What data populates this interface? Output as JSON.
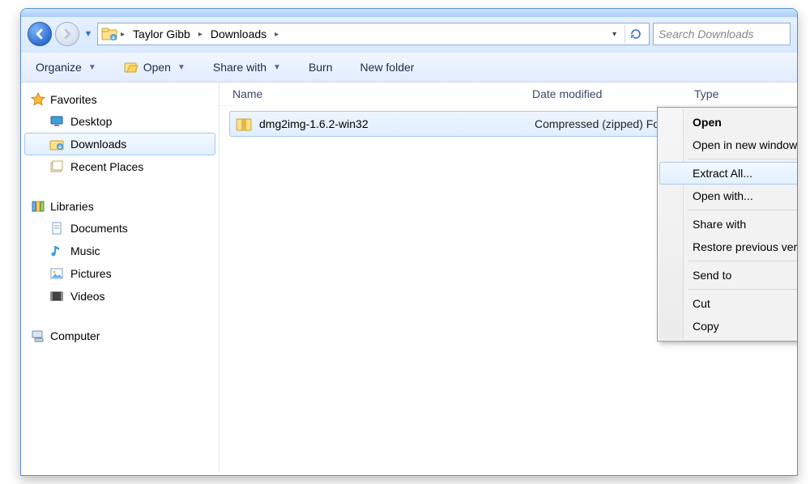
{
  "breadcrumb": {
    "seg1": "Taylor Gibb",
    "seg2": "Downloads"
  },
  "search": {
    "placeholder": "Search Downloads"
  },
  "toolbar": {
    "organize": "Organize",
    "open": "Open",
    "share": "Share with",
    "burn": "Burn",
    "newfolder": "New folder"
  },
  "side": {
    "head_fav": "Favorites",
    "desktop": "Desktop",
    "downloads": "Downloads",
    "recent": "Recent Places",
    "head_lib": "Libraries",
    "docs": "Documents",
    "music": "Music",
    "pics": "Pictures",
    "videos": "Videos",
    "computer": "Computer"
  },
  "cols": {
    "name": "Name",
    "date": "Date modified",
    "type": "Type"
  },
  "file": {
    "name": "dmg2img-1.6.2-win32",
    "type": "Compressed (zipped) Folder"
  },
  "ctx": {
    "open": "Open",
    "opennew": "Open in new window",
    "extract": "Extract All...",
    "openwith": "Open with...",
    "sharewith": "Share with",
    "restore": "Restore previous versions",
    "sendto": "Send to",
    "cut": "Cut",
    "copy": "Copy"
  }
}
